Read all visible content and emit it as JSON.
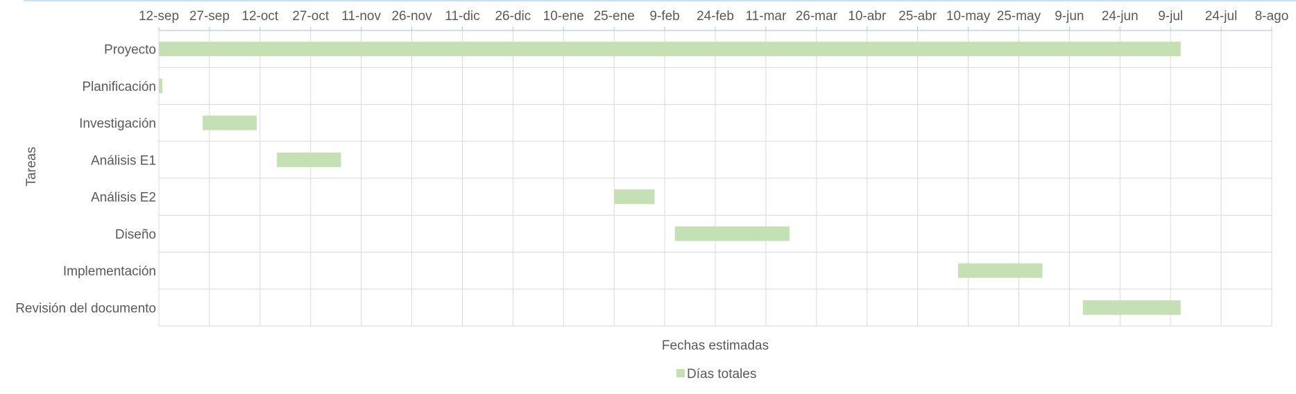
{
  "chart_data": {
    "type": "bar",
    "orientation": "horizontal",
    "subtype": "gantt",
    "xlabel": "Fechas estimadas",
    "ylabel": "Tareas",
    "x_ticks": [
      "12-sep",
      "27-sep",
      "12-oct",
      "27-oct",
      "11-nov",
      "26-nov",
      "11-dic",
      "26-dic",
      "10-ene",
      "25-ene",
      "9-feb",
      "24-feb",
      "11-mar",
      "26-mar",
      "10-abr",
      "25-abr",
      "10-may",
      "25-may",
      "9-jun",
      "24-jun",
      "9-jul",
      "24-jul",
      "8-ago"
    ],
    "x_tick_days": [
      0,
      15,
      30,
      45,
      60,
      75,
      90,
      105,
      120,
      135,
      150,
      165,
      180,
      195,
      210,
      225,
      240,
      255,
      270,
      285,
      300,
      315,
      330
    ],
    "xlim_days": [
      0,
      330
    ],
    "x_axis_position": "top",
    "grid": true,
    "legend": {
      "position": "bottom",
      "entries": [
        "Días totales"
      ]
    },
    "series": [
      {
        "name": "Días totales",
        "color": "#c5e0b4"
      }
    ],
    "tasks": [
      {
        "name": "Proyecto",
        "start": "12-sep",
        "end": "14-jul",
        "start_day": 0,
        "days": 303
      },
      {
        "name": "Planificación",
        "start": "12-sep",
        "end": "13-sep",
        "start_day": 0,
        "days": 1
      },
      {
        "name": "Investigación",
        "start": "25-sep",
        "end": "11-oct",
        "start_day": 13,
        "days": 16
      },
      {
        "name": "Análisis E1",
        "start": "17-oct",
        "end": "5-nov",
        "start_day": 35,
        "days": 19
      },
      {
        "name": "Análisis E2",
        "start": "25-ene",
        "end": "6-feb",
        "start_day": 135,
        "days": 12
      },
      {
        "name": "Diseño",
        "start": "14-feb",
        "end": "20-mar",
        "start_day": 153,
        "days": 34
      },
      {
        "name": "Implementación",
        "start": "8-may",
        "end": "2-jun",
        "start_day": 237,
        "days": 25
      },
      {
        "name": "Revisión del documento",
        "start": "14-jun",
        "end": "13-jul",
        "start_day": 274,
        "days": 29
      }
    ]
  }
}
